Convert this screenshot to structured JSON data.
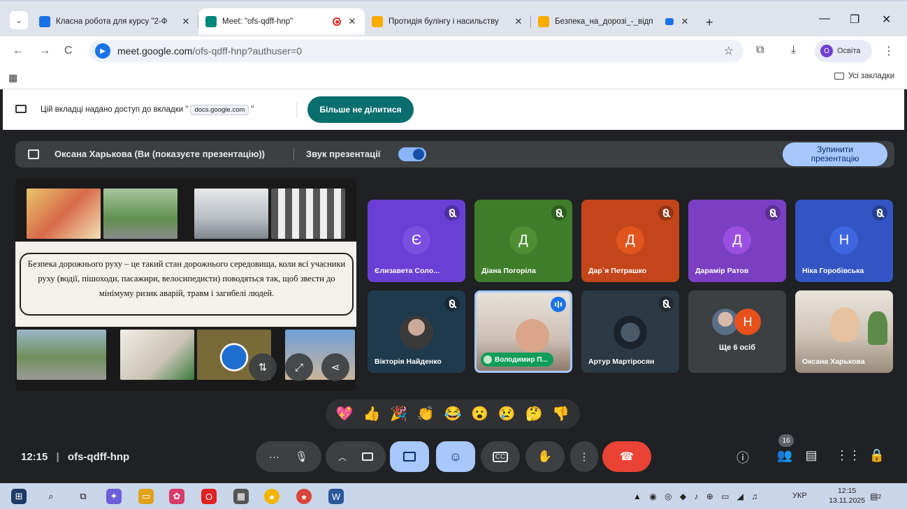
{
  "browser": {
    "tabs": [
      {
        "title": "Класна робота для курсу \"2-Ф",
        "favicon_color": "#1a73e8",
        "active": false
      },
      {
        "title": "Meet: \"ofs-qdff-hnp\"",
        "favicon_color": "#00897b",
        "active": true
      },
      {
        "title": "Протидія булінгу і насильству",
        "favicon_color": "#f9ab00",
        "active": false
      },
      {
        "title": "Безпека_на_дорозі_-_відп",
        "favicon_color": "#f9ab00",
        "active": false
      }
    ],
    "url_host": "meet.google.com",
    "url_path": "/ofs-qdff-hnp?authuser=0",
    "profile_label": "Освіта",
    "profile_initial": "О",
    "bookmarks_label": "Усі закладки"
  },
  "share_bar": {
    "text_before": "Цій вкладці надано доступ до вкладки \"",
    "chip": "docs.google.com",
    "text_after": "\"",
    "stop_button": "Більше не ділитися"
  },
  "presenting": {
    "label": "Оксана Харькова (Ви (показуєте презентацію))",
    "audio_label": "Звук презентації",
    "stop_line1": "Зупинити",
    "stop_line2": "презентацію"
  },
  "slide": {
    "text": "Безпека дорожнього руху – це такий стан дорожнього середовища, коли всі учасники руху (водії, пішоходи, пасажири, велосипедисти) поводяться так, щоб звести до мінімуму ризик аварій, травм і загибелі людей."
  },
  "participants": [
    {
      "name": "Єлизавета Соло...",
      "initial": "Є",
      "tile_color": "#6a3fd6",
      "avatar_color": "#7b4fe0"
    },
    {
      "name": "Діана Погоріла",
      "initial": "Д",
      "tile_color": "#3f7d2a",
      "avatar_color": "#4e8f34"
    },
    {
      "name": "Дар`я Петрашко",
      "initial": "Д",
      "tile_color": "#c4451a",
      "avatar_color": "#e0561e"
    },
    {
      "name": "Дарамір Ратов",
      "initial": "Д",
      "tile_color": "#7b3fc4",
      "avatar_color": "#9a4fe0"
    },
    {
      "name": "Ніка Горобівська",
      "initial": "Н",
      "tile_color": "#3355c4",
      "avatar_color": "#3f66e0"
    },
    {
      "name": "Вікторія Найденко",
      "tile_color": "#1f3a4d"
    },
    {
      "name": "Володимир П...",
      "tile_color": "#d9cfc8"
    },
    {
      "name": "Артур Мартіросян",
      "tile_color": "#2b3a44"
    },
    {
      "name": "Оксана Харькова",
      "tile_color": "#b9a79a"
    }
  ],
  "more_people": {
    "label": "Ще 6 осіб",
    "initial": "Н"
  },
  "reactions": [
    "💖",
    "👍",
    "🎉",
    "👏",
    "😂",
    "😮",
    "😢",
    "🤔",
    "👎"
  ],
  "meeting": {
    "time": "12:15",
    "code": "ofs-qdff-hnp",
    "people_count": "16"
  },
  "taskbar": {
    "lang": "УКР",
    "time": "12:15",
    "date": "13.11.2025",
    "notif_count": "2"
  },
  "icons": {
    "mic": "mic-icon",
    "camera": "camera-icon",
    "present": "present-icon",
    "emoji": "emoji-icon",
    "captions": "captions-icon",
    "hand": "raise-hand-icon",
    "more": "more-options-icon",
    "hangup": "end-call-icon",
    "info": "info-icon",
    "people": "people-icon",
    "chat": "chat-icon",
    "activities": "activities-icon",
    "host": "host-controls-icon"
  }
}
